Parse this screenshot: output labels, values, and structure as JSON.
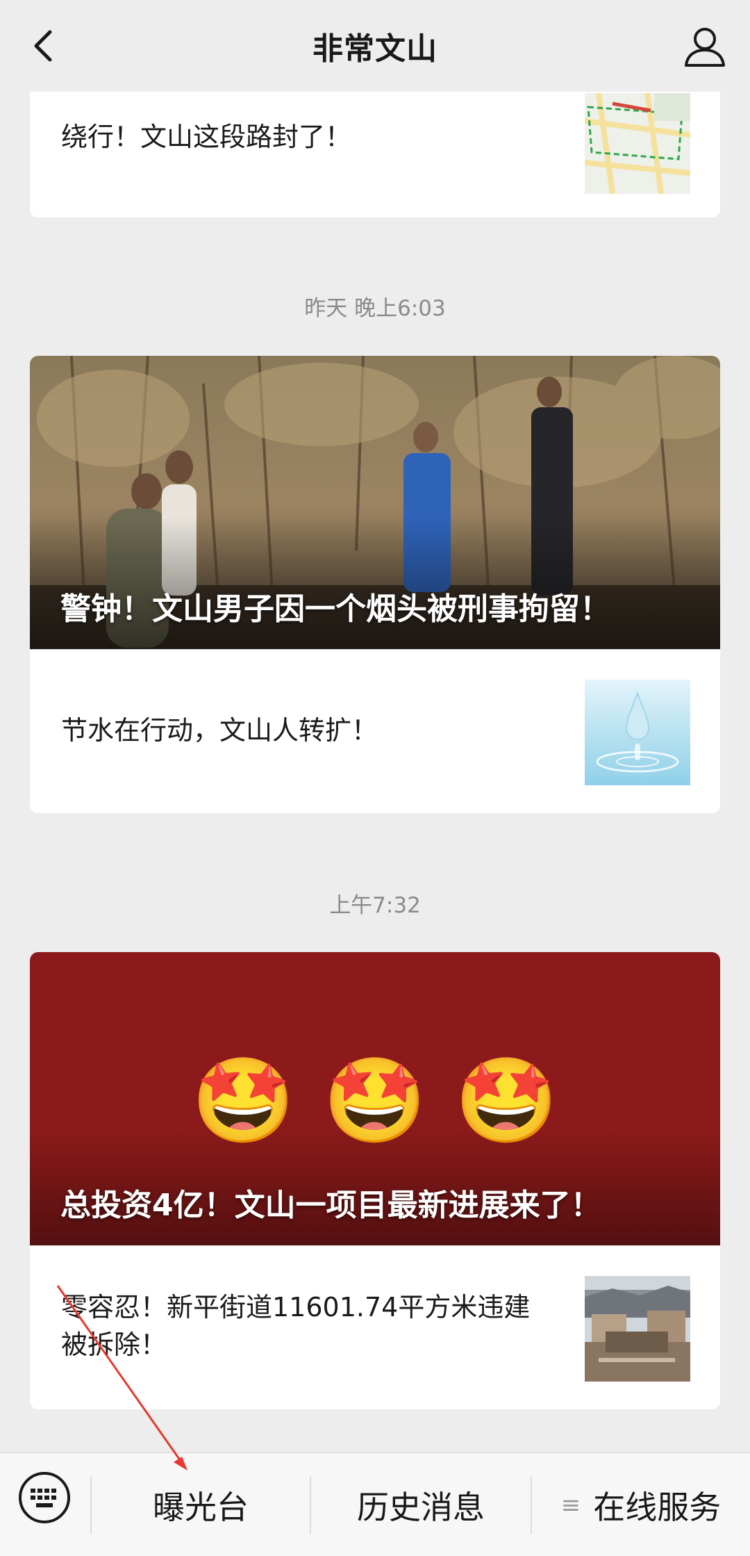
{
  "nav": {
    "title": "非常文山",
    "back_icon": "chevron-left-icon",
    "profile_icon": "person-icon"
  },
  "feed": {
    "group1": {
      "rows": [
        {
          "title": "绕行！文山这段路封了！",
          "thumb": "road-map-thumbnail"
        }
      ]
    },
    "timestamp2": "昨天 晚上6:03",
    "group2": {
      "hero_title": "警钟！文山男子因一个烟头被刑事拘留！",
      "rows": [
        {
          "title": "节水在行动，文山人转扩！",
          "thumb": "water-drop-thumbnail"
        }
      ]
    },
    "timestamp3": "上午7:32",
    "group3": {
      "hero_title": "总投资4亿！文山一项目最新进展来了！",
      "hero_emojis": [
        "🤩",
        "🤩",
        "🤩"
      ],
      "rows": [
        {
          "title": "零容忍！新平街道11601.74平方米违建被拆除！",
          "thumb": "building-site-thumbnail"
        }
      ]
    }
  },
  "bottom_menu": {
    "keyboard_icon": "keyboard-icon",
    "items": [
      {
        "label": "曝光台"
      },
      {
        "label": "历史消息"
      },
      {
        "label": "在线服务",
        "icon": "menu-lines-icon"
      }
    ]
  },
  "colors": {
    "background": "#ededed",
    "card": "#ffffff",
    "hero3_bg": "#8c1a1a",
    "annotation_arrow": "#e8382f"
  }
}
